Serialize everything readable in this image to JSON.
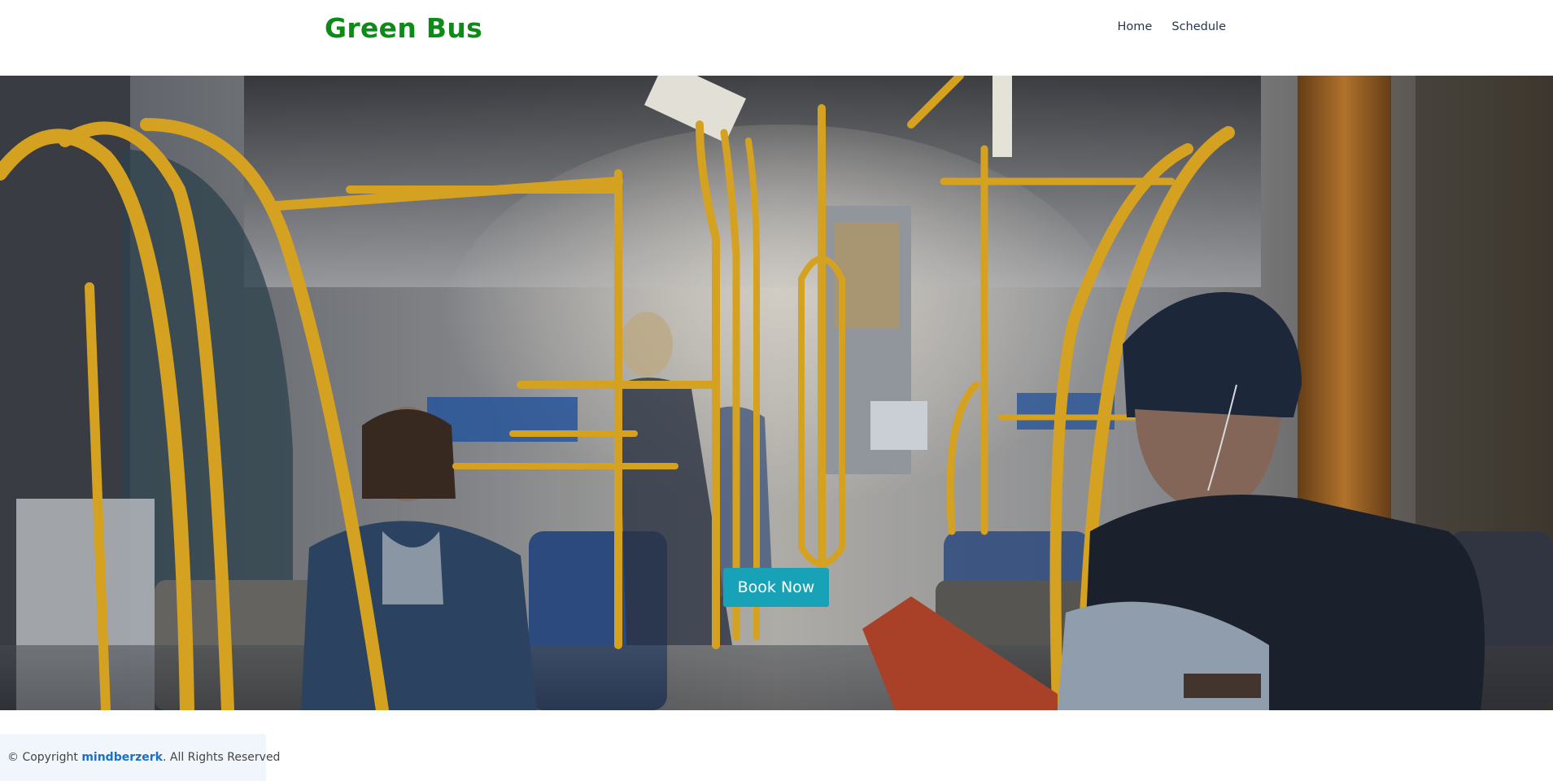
{
  "header": {
    "brand": "Green Bus",
    "nav": [
      {
        "label": "Home"
      },
      {
        "label": "Schedule"
      }
    ]
  },
  "hero": {
    "cta_label": "Book Now",
    "image": "bus-interior-photo"
  },
  "footer": {
    "prefix": "© Copyright ",
    "owner": "mindberzerk",
    "suffix": ". All Rights Reserved"
  },
  "colors": {
    "brand": "#0d8a17",
    "cta": "#17a2b8",
    "link": "#1c6fc7",
    "footer_bg": "#f1f6fd"
  }
}
